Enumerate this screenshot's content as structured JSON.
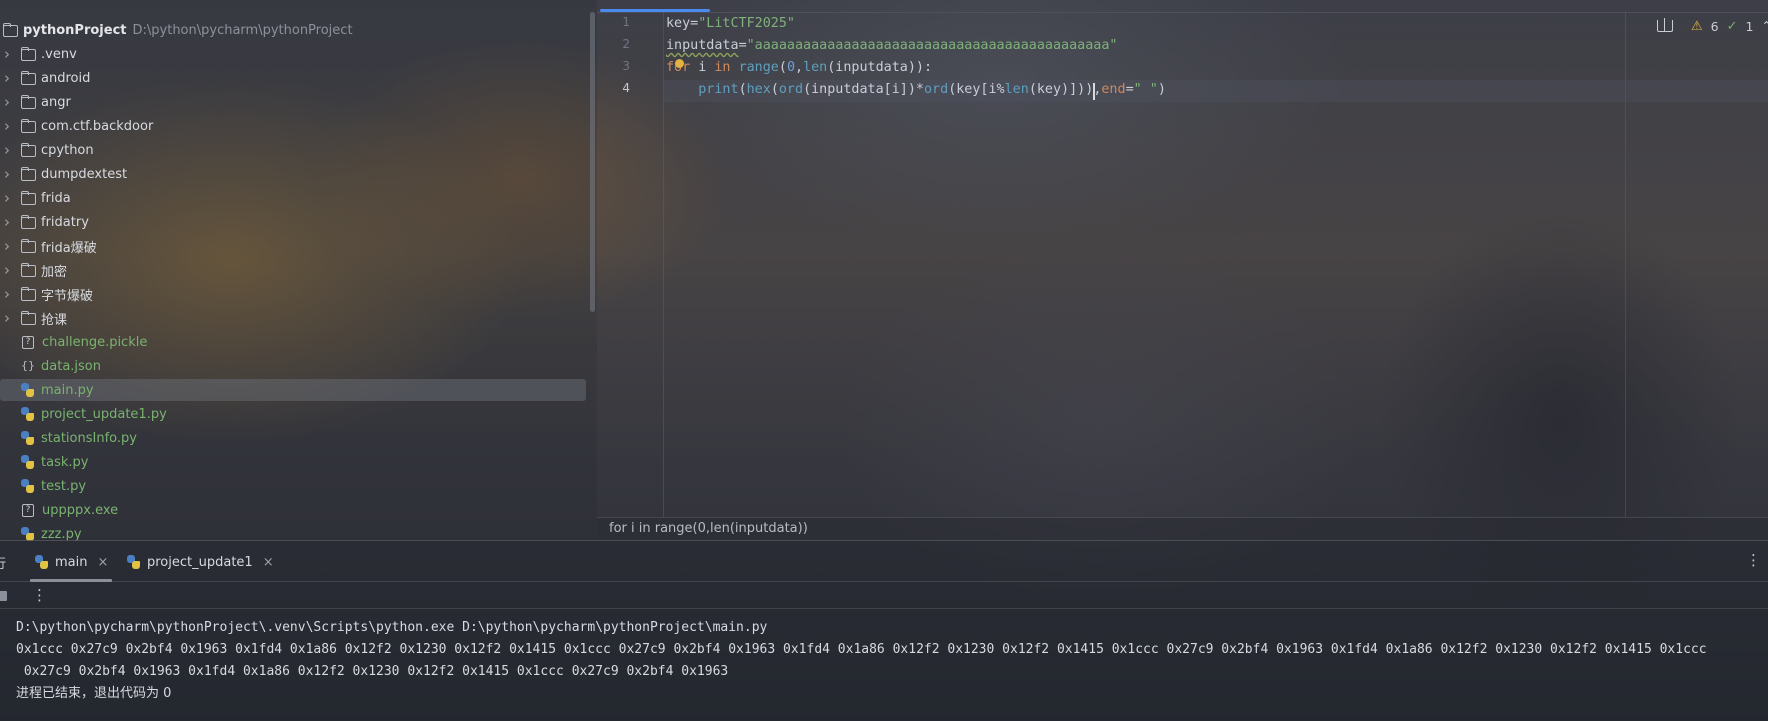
{
  "project": {
    "name": "pythonProject",
    "path": "D:\\python\\pycharm\\pythonProject",
    "items": [
      {
        "label": ".venv",
        "kind": "folder",
        "color": "dir"
      },
      {
        "label": "android",
        "kind": "folder",
        "color": "dir"
      },
      {
        "label": "angr",
        "kind": "folder",
        "color": "dir"
      },
      {
        "label": "com.ctf.backdoor",
        "kind": "folder",
        "color": "dir"
      },
      {
        "label": "cpython",
        "kind": "folder",
        "color": "dir"
      },
      {
        "label": "dumpdextest",
        "kind": "folder",
        "color": "dir"
      },
      {
        "label": "frida",
        "kind": "folder",
        "color": "dir"
      },
      {
        "label": "fridatry",
        "kind": "folder",
        "color": "dir"
      },
      {
        "label": "frida爆破",
        "kind": "folder",
        "color": "dir"
      },
      {
        "label": "加密",
        "kind": "folder",
        "color": "dir"
      },
      {
        "label": "字节爆破",
        "kind": "folder",
        "color": "dir"
      },
      {
        "label": "抢课",
        "kind": "folder",
        "color": "dir"
      },
      {
        "label": "challenge.pickle",
        "kind": "unknown",
        "color": "green"
      },
      {
        "label": "data.json",
        "kind": "json",
        "color": "green"
      },
      {
        "label": "main.py",
        "kind": "python",
        "color": "green",
        "selected": true
      },
      {
        "label": "project_update1.py",
        "kind": "python",
        "color": "green"
      },
      {
        "label": "stationsInfo.py",
        "kind": "python",
        "color": "green"
      },
      {
        "label": "task.py",
        "kind": "python",
        "color": "green"
      },
      {
        "label": "test.py",
        "kind": "python",
        "color": "green"
      },
      {
        "label": "uppppx.exe",
        "kind": "unknown",
        "color": "green"
      },
      {
        "label": "zzz.py",
        "kind": "python",
        "color": "green"
      }
    ]
  },
  "editor": {
    "line_numbers": [
      "1",
      "2",
      "3",
      "4"
    ],
    "code": {
      "l1_a": "key=",
      "l1_b": "\"LitCTF2025\"",
      "l2_a": "inputdata",
      "l2_b": "=",
      "l2_c": "\"aaaaaaaaaaaaaaaaaaaaaaaaaaaaaaaaaaaaaaaaaaaa\"",
      "l3_a": "for",
      "l3_b": " i ",
      "l3_c": "in",
      "l3_d": " ",
      "l3_e": "range",
      "l3_f": "(",
      "l3_g": "0",
      "l3_h": ",",
      "l3_i": "len",
      "l3_j": "(inputdata)):",
      "l4_a": "    ",
      "l4_b": "print",
      "l4_c": "(",
      "l4_d": "hex",
      "l4_e": "(",
      "l4_f": "ord",
      "l4_g": "(inputdata[i])*",
      "l4_h": "ord",
      "l4_i": "(key[i%",
      "l4_j": "len",
      "l4_k": "(key)])",
      "l4_l": ")",
      "l4_m": ",",
      "l4_n": "end",
      "l4_o": "=",
      "l4_p": "\" \"",
      "l4_q": ")"
    },
    "warnings_count": "6",
    "checks_count": "1",
    "breadcrumb": "for i in range(0,len(inputdata))"
  },
  "run": {
    "cut_tab_glyph": "行",
    "tabs": [
      {
        "label": "main",
        "icon": "python-icon"
      },
      {
        "label": "project_update1",
        "icon": "python-icon"
      }
    ],
    "console": {
      "command": "D:\\python\\pycharm\\pythonProject\\.venv\\Scripts\\python.exe D:\\python\\pycharm\\pythonProject\\main.py",
      "output_1": "0x1ccc 0x27c9 0x2bf4 0x1963 0x1fd4 0x1a86 0x12f2 0x1230 0x12f2 0x1415 0x1ccc 0x27c9 0x2bf4 0x1963 0x1fd4 0x1a86 0x12f2 0x1230 0x12f2 0x1415 0x1ccc 0x27c9 0x2bf4 0x1963 0x1fd4 0x1a86 0x12f2 0x1230 0x12f2 0x1415 0x1ccc",
      "output_2": " 0x27c9 0x2bf4 0x1963 0x1fd4 0x1a86 0x12f2 0x1230 0x12f2 0x1415 0x1ccc 0x27c9 0x2bf4 0x1963",
      "exit": "进程已结束，退出代码为 0"
    }
  },
  "colors": {
    "string": "#7fb27a",
    "keyword": "#d0895a",
    "number": "#6fa0d8",
    "builtin": "#5f9fbf",
    "accent": "#4a8bf0"
  }
}
